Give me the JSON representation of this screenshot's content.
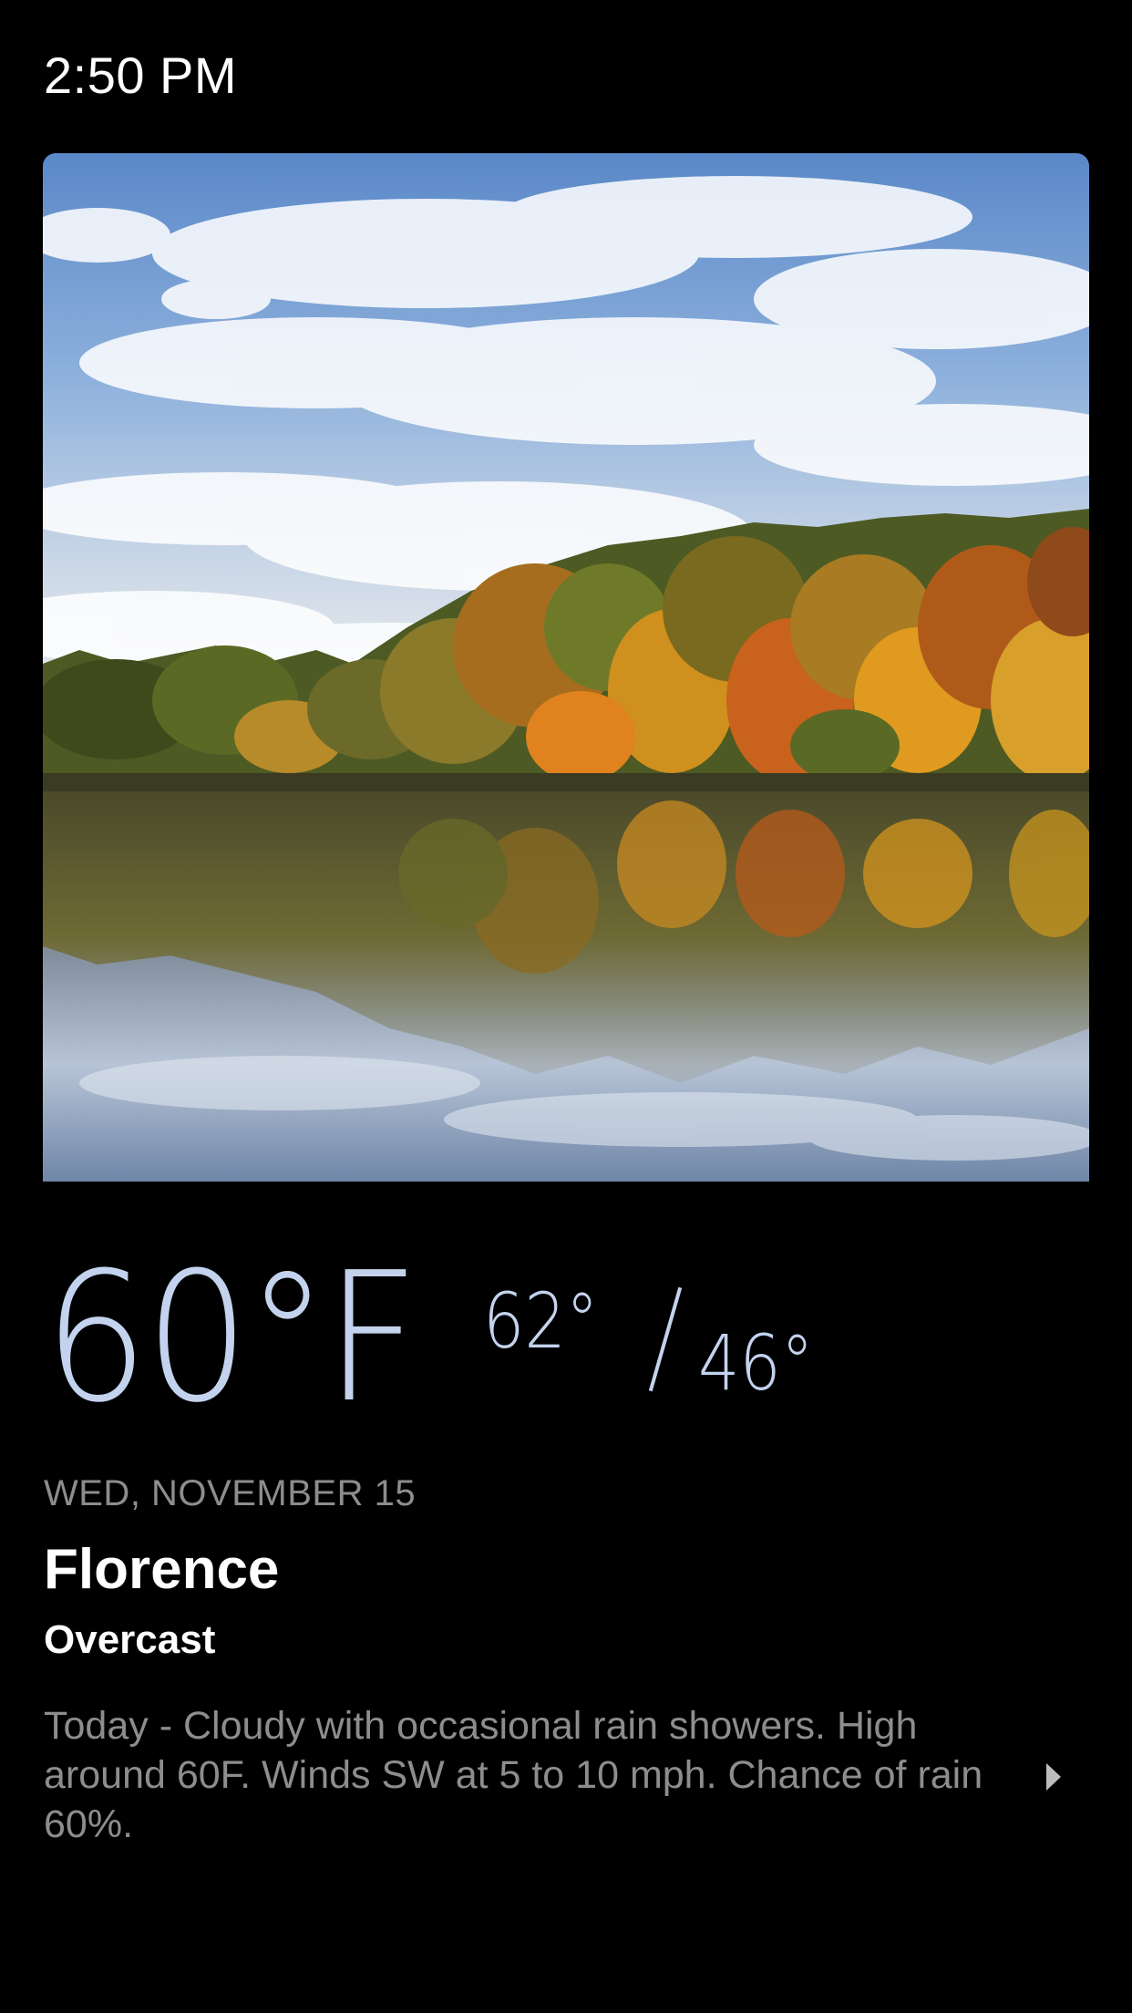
{
  "status_bar": {
    "time": "2:50 PM"
  },
  "hero_image": {
    "description_icon": "autumn-lake-photo"
  },
  "weather": {
    "current_temp": "60°F",
    "high": "62°",
    "low": "46°",
    "date": "WED, NOVEMBER 15",
    "city": "Florence",
    "condition": "Overcast",
    "forecast": "Today - Cloudy with occasional rain showers. High around 60F. Winds SW at 5 to 10 mph. Chance of rain 60%."
  },
  "colors": {
    "background": "#000000",
    "temperature": "#c3d3ee",
    "secondary_text": "#8d8d8f",
    "primary_text": "#ffffff"
  },
  "icons": {
    "forecast_more": "chevron-right-icon"
  }
}
